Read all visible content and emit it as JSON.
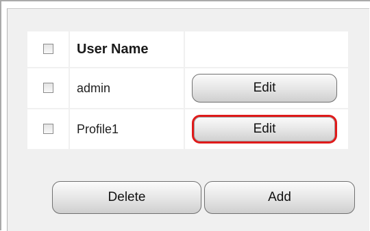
{
  "table": {
    "header": {
      "select_all_checked": false,
      "user_name_label": "User Name"
    },
    "rows": [
      {
        "checked": false,
        "user_name": "admin",
        "action_label": "Edit",
        "highlighted": false
      },
      {
        "checked": false,
        "user_name": "Profile1",
        "action_label": "Edit",
        "highlighted": true
      }
    ]
  },
  "actions": {
    "delete_label": "Delete",
    "add_label": "Add"
  },
  "colors": {
    "panel_background": "#f0f0f0",
    "highlight_border": "#e01a1a"
  }
}
